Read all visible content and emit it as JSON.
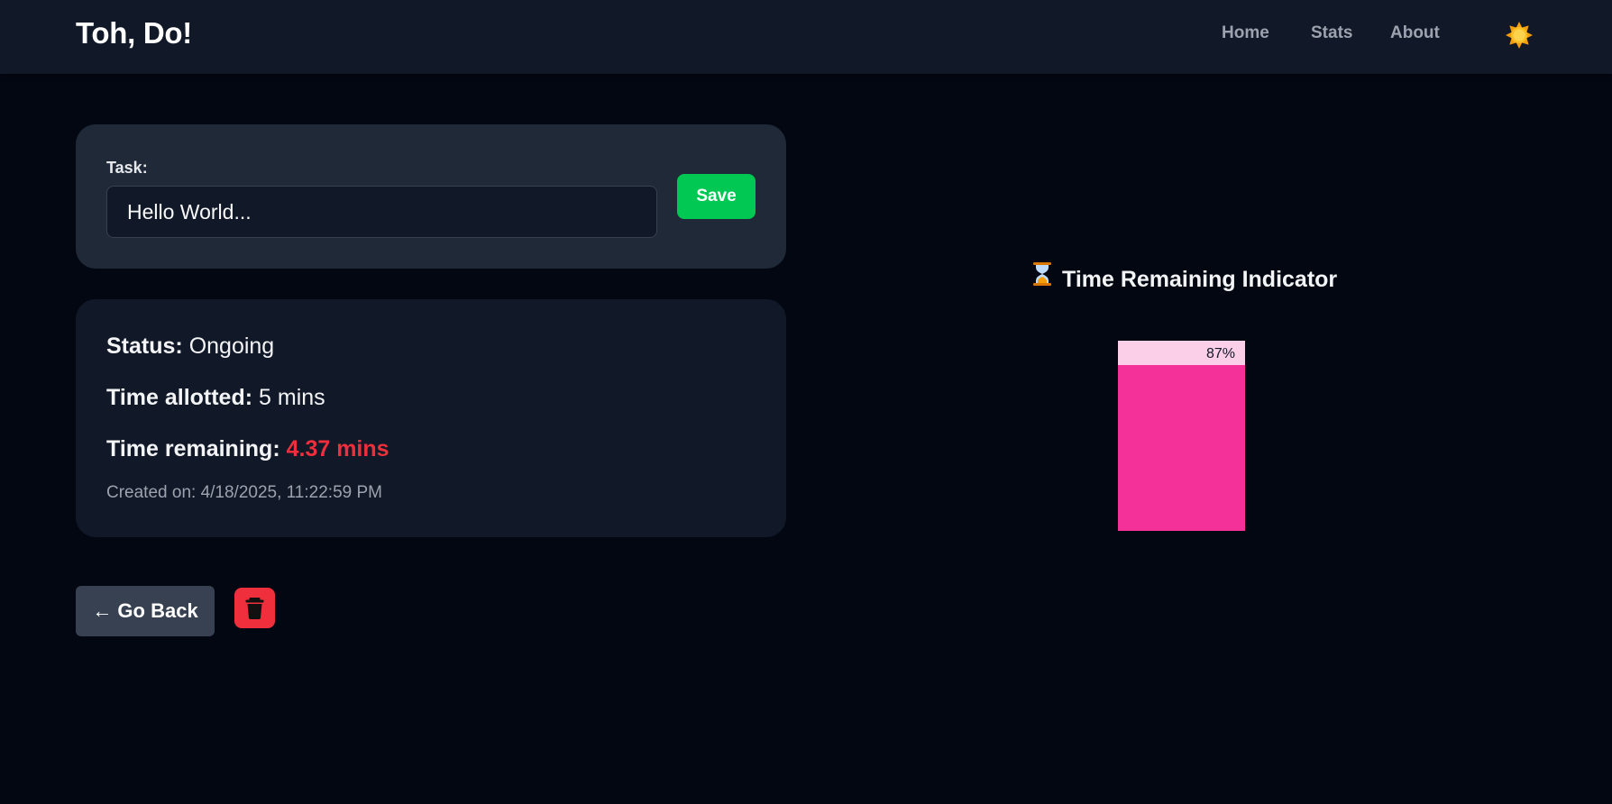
{
  "nav": {
    "brand": "Toh, Do!",
    "links": [
      "Home",
      "Stats",
      "About"
    ],
    "theme_icon": "sun-icon"
  },
  "task_form": {
    "label": "Task:",
    "value": "Hello World...",
    "save_label": "Save"
  },
  "details": {
    "status_key": "Status:",
    "status_value": "Ongoing",
    "allotted_key": "Time allotted:",
    "allotted_value": "5 mins",
    "remaining_key": "Time remaining:",
    "remaining_value": "4.37 mins",
    "created": "Created on: 4/18/2025, 11:22:59 PM"
  },
  "actions": {
    "back_label": "← Go Back",
    "delete_icon": "trash-icon"
  },
  "indicator": {
    "title": "Time Remaining Indicator",
    "icon": "hourglass-icon",
    "percent": 87,
    "percent_label": "87%"
  },
  "colors": {
    "accent_green": "#00c853",
    "danger_red": "#ef2f3c",
    "bar_fill": "#f43198",
    "bar_track": "#fbcfe8"
  }
}
